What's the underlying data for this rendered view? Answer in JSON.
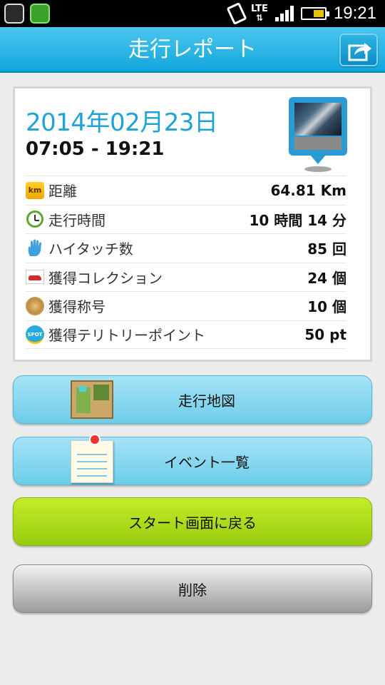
{
  "statusbar": {
    "network": "LTE",
    "time": "19:21"
  },
  "header": {
    "title": "走行レポート"
  },
  "report": {
    "date": "2014年02月23日",
    "time_range": "07:05 - 19:21",
    "stats": [
      {
        "icon": "km-icon",
        "label": "距離",
        "value": "64.81 Km"
      },
      {
        "icon": "clock-icon",
        "label": "走行時間",
        "value": "10 時間 14 分"
      },
      {
        "icon": "hand-icon",
        "label": "ハイタッチ数",
        "value": "85 回"
      },
      {
        "icon": "car-icon",
        "label": "獲得コレクション",
        "value": "24 個"
      },
      {
        "icon": "medal-icon",
        "label": "獲得称号",
        "value": "10 個"
      },
      {
        "icon": "spot-icon",
        "label": "獲得テリトリーポイント",
        "value": "50 pt"
      }
    ],
    "spot_badge": "SPOT",
    "km_badge": "km"
  },
  "buttons": {
    "map": "走行地図",
    "events": "イベント一覧",
    "back": "スタート画面に戻る",
    "delete": "削除"
  },
  "colors": {
    "header": "#1aaee0",
    "date": "#1fa3d6",
    "green_button": "#a9d81a"
  }
}
